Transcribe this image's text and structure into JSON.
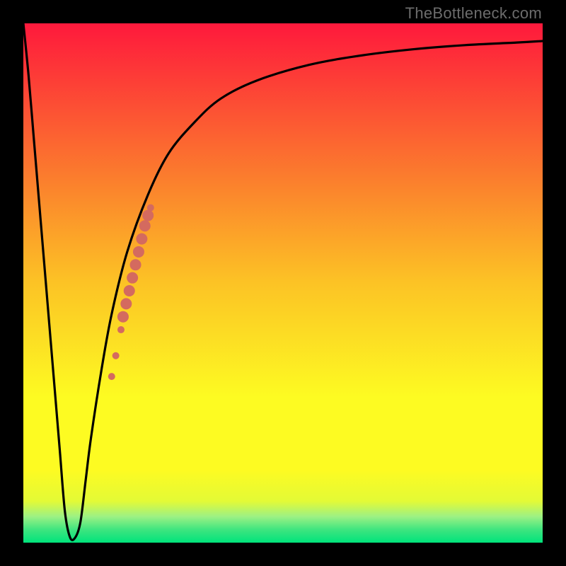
{
  "watermark": "TheBottleneck.com",
  "colors": {
    "gradient_top": "#fe193c",
    "gradient_mid_upper": "#fb7e2d",
    "gradient_mid": "#fcc325",
    "gradient_mid_lower": "#fdfb22",
    "gradient_lower": "#e3fa36",
    "gradient_green1": "#9cf184",
    "gradient_green2": "#3ee57f",
    "gradient_bottom": "#00e37c",
    "curve": "#000000",
    "marker": "#d46a5f",
    "frame": "#000000"
  },
  "chart_data": {
    "type": "line",
    "title": "",
    "xlabel": "",
    "ylabel": "",
    "xlim": [
      0,
      100
    ],
    "ylim": [
      0,
      100
    ],
    "series": [
      {
        "name": "bottleneck-curve",
        "x": [
          0,
          1,
          2,
          3,
          4,
          5,
          6,
          7,
          8,
          9,
          10,
          11,
          12,
          13,
          15,
          17,
          20,
          24,
          28,
          33,
          38,
          45,
          55,
          65,
          75,
          85,
          95,
          100
        ],
        "y": [
          100,
          90,
          78,
          66,
          54,
          42,
          30,
          18,
          6,
          1,
          1,
          4,
          12,
          20,
          33,
          44,
          56,
          67,
          75,
          81,
          85.5,
          89,
          92,
          93.8,
          95,
          95.8,
          96.3,
          96.6
        ]
      }
    ],
    "markers": {
      "name": "highlight-segment",
      "points": [
        {
          "x": 17.0,
          "y": 32.0,
          "r": 5
        },
        {
          "x": 17.8,
          "y": 36.0,
          "r": 5
        },
        {
          "x": 18.8,
          "y": 41.0,
          "r": 5
        },
        {
          "x": 19.2,
          "y": 43.5,
          "r": 8
        },
        {
          "x": 19.8,
          "y": 46.0,
          "r": 8
        },
        {
          "x": 20.4,
          "y": 48.5,
          "r": 8
        },
        {
          "x": 21.0,
          "y": 51.0,
          "r": 8
        },
        {
          "x": 21.6,
          "y": 53.5,
          "r": 8
        },
        {
          "x": 22.2,
          "y": 56.0,
          "r": 8
        },
        {
          "x": 22.8,
          "y": 58.5,
          "r": 8
        },
        {
          "x": 23.4,
          "y": 61.0,
          "r": 8
        },
        {
          "x": 24.0,
          "y": 63.0,
          "r": 8
        },
        {
          "x": 24.5,
          "y": 64.5,
          "r": 5
        }
      ]
    }
  }
}
